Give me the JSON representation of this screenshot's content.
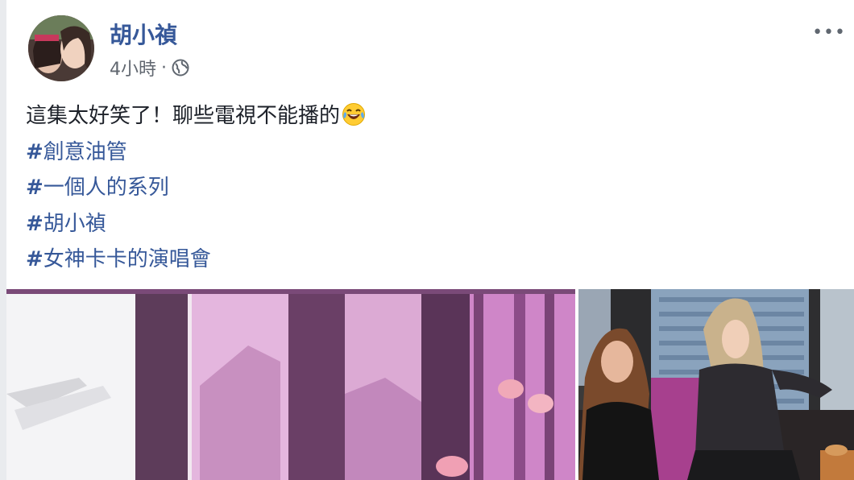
{
  "post": {
    "author": "胡小禎",
    "timestamp": "4小時",
    "separator": "·",
    "more_label": "•••",
    "text": "這集太好笑了！聊些電視不能播的",
    "hashtags": [
      {
        "hash": "#",
        "label": "創意油管"
      },
      {
        "hash": "#",
        "label": "一個人的系列"
      },
      {
        "hash": "#",
        "label": "胡小禎"
      },
      {
        "hash": "#",
        "label": "女神卡卡的演唱會"
      }
    ]
  },
  "colors": {
    "link": "#365899",
    "meta": "#616770",
    "text": "#1d2129",
    "window_pink": "#d26ed0"
  },
  "icons": {
    "privacy": "globe-icon",
    "emoji": "tears-of-joy-emoji",
    "menu": "more-options-icon"
  }
}
